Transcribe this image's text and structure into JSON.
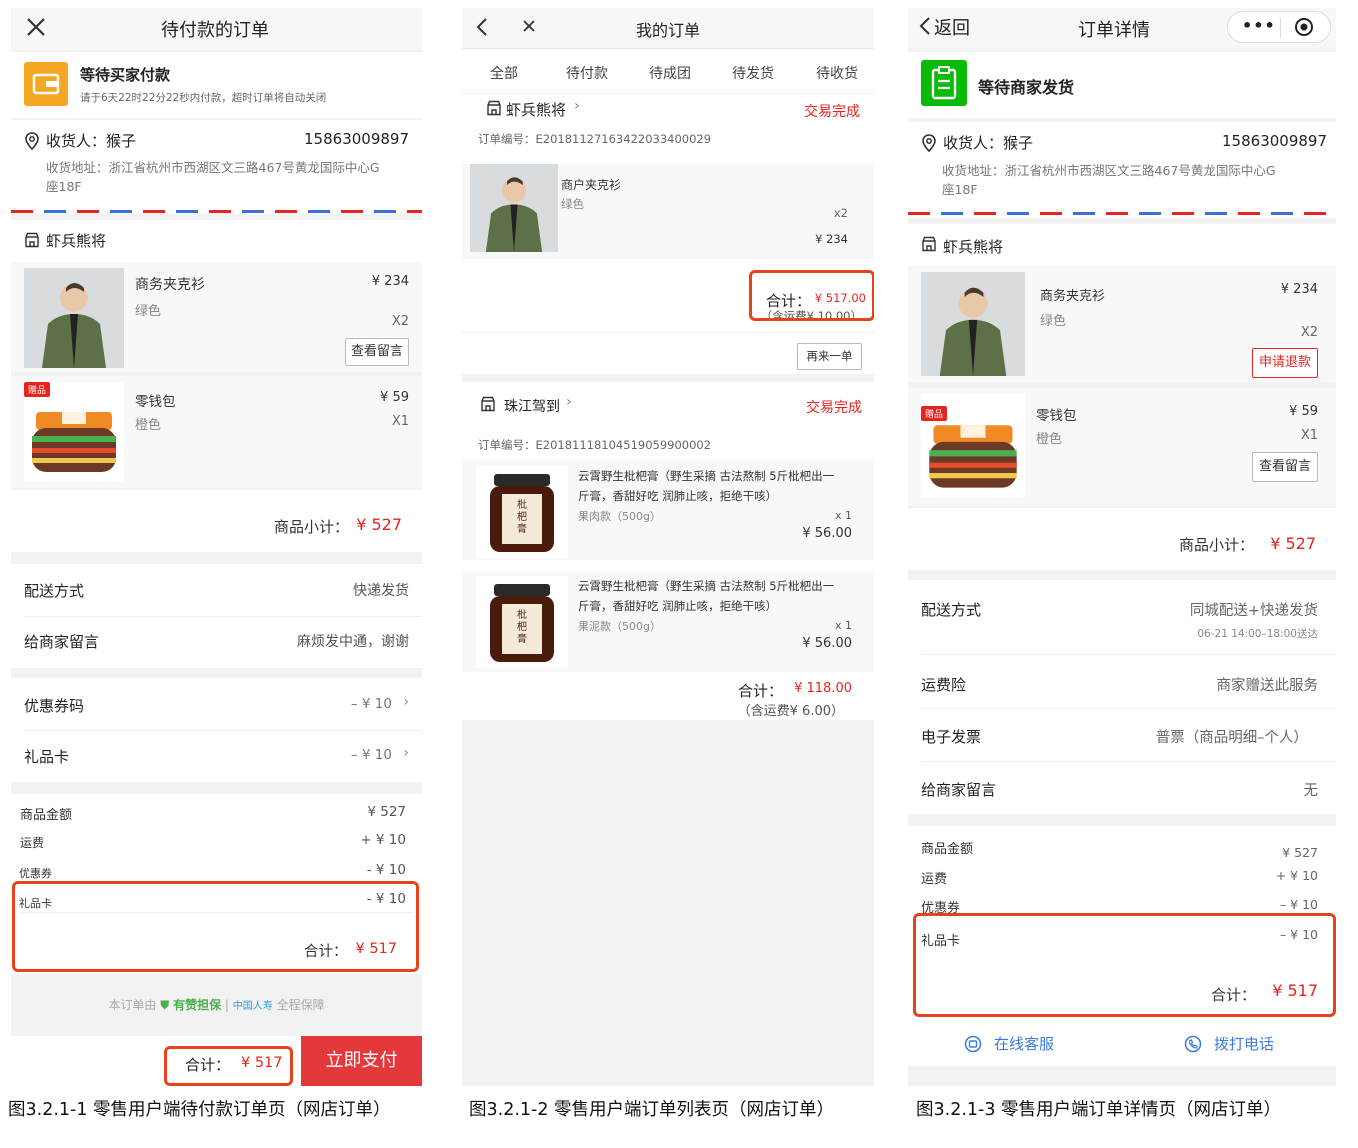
{
  "screen1": {
    "nav_title": "待付款的订单",
    "status_title": "等待买家付款",
    "status_sub": "请于6天22时22分22秒内付款，超时订单将自动关闭",
    "receiver_label": "收货人：猴子",
    "receiver_phone": "15863009897",
    "address_line1": "收货地址：浙江省杭州市西湖区文三路467号黄龙国际中心G",
    "address_line2": "座18F",
    "shop_name": "虾兵熊将",
    "item1_name": "商务夹克衫",
    "item1_spec": "绿色",
    "item1_price": "¥ 234",
    "item1_qty": "X2",
    "item1_btn": "查看留言",
    "gift_badge": "赠品",
    "item2_name": "零钱包",
    "item2_spec": "橙色",
    "item2_price": "¥ 59",
    "item2_qty": "X1",
    "subtotal_label": "商品小计：",
    "subtotal_value": "¥ 527",
    "delivery_label": "配送方式",
    "delivery_value": "快递发货",
    "message_label": "给商家留言",
    "message_value": "麻烦发中通，谢谢",
    "coupon_label": "优惠券码",
    "coupon_value": "– ¥ 10",
    "giftcard_label": "礼品卡",
    "giftcard_value": "– ¥ 10",
    "amount_label": "商品金额",
    "amount_value": "¥ 527",
    "freight_label": "运费",
    "freight_value": "+ ¥ 10",
    "discount_label": "优惠券",
    "discount_value": "- ¥ 10",
    "gift2_label": "礼品卡",
    "gift2_value": "- ¥ 10",
    "total_label": "合计：",
    "total_value": "¥ 517",
    "guarantee_prefix": "本订单由",
    "guarantee_brand": "有赞担保",
    "guarantee_sep": "|",
    "guarantee_partner": "中国人寿",
    "guarantee_suffix": "全程保障",
    "bar_total_label": "合计：",
    "bar_total_value": "¥ 517",
    "pay_button": "立即支付"
  },
  "screen2": {
    "nav_title": "我的订单",
    "tabs": [
      "全部",
      "待付款",
      "待成团",
      "待发货",
      "待收货"
    ],
    "order1": {
      "shop": "虾兵熊将",
      "status": "交易完成",
      "order_no": "订单编号：E20181127163422033400029",
      "item_name": "商户夹克衫",
      "item_spec": "绿色",
      "item_qty": "x2",
      "item_price": "¥ 234",
      "total_label": "合计：",
      "total_value": "¥ 517.00",
      "freight_note": "（含运费¥ 10.00）",
      "reorder_button": "再来一单"
    },
    "order2": {
      "shop": "珠江驾到",
      "status": "交易完成",
      "order_no": "订单编号：E20181118104519059900002",
      "item1_line1": "云霄野生枇杷膏（野生采摘 古法熬制 5斤枇杷出一",
      "item1_line2": "斤膏，香甜好吃 润肺止咳，拒绝干咳）",
      "item1_spec": "果肉款（500g）",
      "item1_qty": "x 1",
      "item1_price": "¥ 56.00",
      "item2_line1": "云霄野生枇杷膏（野生采摘 古法熬制 5斤枇杷出一",
      "item2_line2": "斤膏，香甜好吃 润肺止咳，拒绝干咳）",
      "item2_spec": "果泥款（500g）",
      "item2_qty": "x 1",
      "item2_price": "¥ 56.00",
      "total_label": "合计：",
      "total_value": "¥ 118.00",
      "freight_note": "（含运费¥ 6.00）",
      "jar_label": "枇杷膏"
    }
  },
  "screen3": {
    "back_label": "返回",
    "nav_title": "订单详情",
    "status_title": "等待商家发货",
    "receiver_label": "收货人：猴子",
    "receiver_phone": "15863009897",
    "address_line1": "收货地址：浙江省杭州市西湖区文三路467号黄龙国际中心G",
    "address_line2": "座18F",
    "shop_name": "虾兵熊将",
    "item1_name": "商务夹克衫",
    "item1_spec": "绿色",
    "item1_price": "¥ 234",
    "item1_qty": "X2",
    "item1_btn": "申请退款",
    "gift_badge": "赠品",
    "item2_name": "零钱包",
    "item2_spec": "橙色",
    "item2_price": "¥ 59",
    "item2_qty": "X1",
    "item2_btn": "查看留言",
    "subtotal_label": "商品小计：",
    "subtotal_value": "¥ 527",
    "delivery_label": "配送方式",
    "delivery_value": "同城配送+快递发货",
    "delivery_time": "06-21 14:00–18:00送达",
    "insurance_label": "运费险",
    "insurance_value": "商家赠送此服务",
    "invoice_label": "电子发票",
    "invoice_value": "普票（商品明细–个人）",
    "message_label": "给商家留言",
    "message_value": "无",
    "amount_label": "商品金额",
    "amount_value": "¥ 527",
    "freight_label": "运费",
    "freight_value": "+ ¥ 10",
    "discount_label": "优惠券",
    "discount_value": "– ¥ 10",
    "gift2_label": "礼品卡",
    "gift2_value": "– ¥ 10",
    "total_label": "合计：",
    "total_value": "¥ 517",
    "service_button": "在线客服",
    "call_button": "拨打电话"
  },
  "captions": {
    "c1": "图3.2.1-1 零售用户端待付款订单页（网店订单）",
    "c2": "图3.2.1-2 零售用户端订单列表页（网店订单）",
    "c3": "图3.2.1-3 零售用户端订单详情页（网店订单）"
  },
  "colors": {
    "accent_red": "#e5251f",
    "highlight_box": "#e8421d",
    "status_orange": "#f5a623",
    "status_green": "#09bb07"
  }
}
